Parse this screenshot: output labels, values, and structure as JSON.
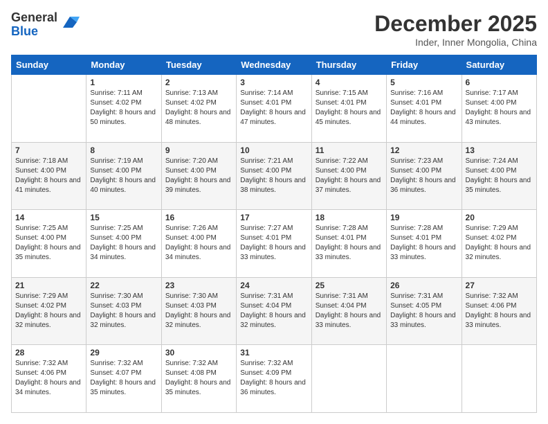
{
  "logo": {
    "general": "General",
    "blue": "Blue"
  },
  "header": {
    "month": "December 2025",
    "location": "Inder, Inner Mongolia, China"
  },
  "weekdays": [
    "Sunday",
    "Monday",
    "Tuesday",
    "Wednesday",
    "Thursday",
    "Friday",
    "Saturday"
  ],
  "weeks": [
    [
      {
        "day": "",
        "sunrise": "",
        "sunset": "",
        "daylight": ""
      },
      {
        "day": "1",
        "sunrise": "Sunrise: 7:11 AM",
        "sunset": "Sunset: 4:02 PM",
        "daylight": "Daylight: 8 hours and 50 minutes."
      },
      {
        "day": "2",
        "sunrise": "Sunrise: 7:13 AM",
        "sunset": "Sunset: 4:02 PM",
        "daylight": "Daylight: 8 hours and 48 minutes."
      },
      {
        "day": "3",
        "sunrise": "Sunrise: 7:14 AM",
        "sunset": "Sunset: 4:01 PM",
        "daylight": "Daylight: 8 hours and 47 minutes."
      },
      {
        "day": "4",
        "sunrise": "Sunrise: 7:15 AM",
        "sunset": "Sunset: 4:01 PM",
        "daylight": "Daylight: 8 hours and 45 minutes."
      },
      {
        "day": "5",
        "sunrise": "Sunrise: 7:16 AM",
        "sunset": "Sunset: 4:01 PM",
        "daylight": "Daylight: 8 hours and 44 minutes."
      },
      {
        "day": "6",
        "sunrise": "Sunrise: 7:17 AM",
        "sunset": "Sunset: 4:00 PM",
        "daylight": "Daylight: 8 hours and 43 minutes."
      }
    ],
    [
      {
        "day": "7",
        "sunrise": "Sunrise: 7:18 AM",
        "sunset": "Sunset: 4:00 PM",
        "daylight": "Daylight: 8 hours and 41 minutes."
      },
      {
        "day": "8",
        "sunrise": "Sunrise: 7:19 AM",
        "sunset": "Sunset: 4:00 PM",
        "daylight": "Daylight: 8 hours and 40 minutes."
      },
      {
        "day": "9",
        "sunrise": "Sunrise: 7:20 AM",
        "sunset": "Sunset: 4:00 PM",
        "daylight": "Daylight: 8 hours and 39 minutes."
      },
      {
        "day": "10",
        "sunrise": "Sunrise: 7:21 AM",
        "sunset": "Sunset: 4:00 PM",
        "daylight": "Daylight: 8 hours and 38 minutes."
      },
      {
        "day": "11",
        "sunrise": "Sunrise: 7:22 AM",
        "sunset": "Sunset: 4:00 PM",
        "daylight": "Daylight: 8 hours and 37 minutes."
      },
      {
        "day": "12",
        "sunrise": "Sunrise: 7:23 AM",
        "sunset": "Sunset: 4:00 PM",
        "daylight": "Daylight: 8 hours and 36 minutes."
      },
      {
        "day": "13",
        "sunrise": "Sunrise: 7:24 AM",
        "sunset": "Sunset: 4:00 PM",
        "daylight": "Daylight: 8 hours and 35 minutes."
      }
    ],
    [
      {
        "day": "14",
        "sunrise": "Sunrise: 7:25 AM",
        "sunset": "Sunset: 4:00 PM",
        "daylight": "Daylight: 8 hours and 35 minutes."
      },
      {
        "day": "15",
        "sunrise": "Sunrise: 7:25 AM",
        "sunset": "Sunset: 4:00 PM",
        "daylight": "Daylight: 8 hours and 34 minutes."
      },
      {
        "day": "16",
        "sunrise": "Sunrise: 7:26 AM",
        "sunset": "Sunset: 4:00 PM",
        "daylight": "Daylight: 8 hours and 34 minutes."
      },
      {
        "day": "17",
        "sunrise": "Sunrise: 7:27 AM",
        "sunset": "Sunset: 4:01 PM",
        "daylight": "Daylight: 8 hours and 33 minutes."
      },
      {
        "day": "18",
        "sunrise": "Sunrise: 7:28 AM",
        "sunset": "Sunset: 4:01 PM",
        "daylight": "Daylight: 8 hours and 33 minutes."
      },
      {
        "day": "19",
        "sunrise": "Sunrise: 7:28 AM",
        "sunset": "Sunset: 4:01 PM",
        "daylight": "Daylight: 8 hours and 33 minutes."
      },
      {
        "day": "20",
        "sunrise": "Sunrise: 7:29 AM",
        "sunset": "Sunset: 4:02 PM",
        "daylight": "Daylight: 8 hours and 32 minutes."
      }
    ],
    [
      {
        "day": "21",
        "sunrise": "Sunrise: 7:29 AM",
        "sunset": "Sunset: 4:02 PM",
        "daylight": "Daylight: 8 hours and 32 minutes."
      },
      {
        "day": "22",
        "sunrise": "Sunrise: 7:30 AM",
        "sunset": "Sunset: 4:03 PM",
        "daylight": "Daylight: 8 hours and 32 minutes."
      },
      {
        "day": "23",
        "sunrise": "Sunrise: 7:30 AM",
        "sunset": "Sunset: 4:03 PM",
        "daylight": "Daylight: 8 hours and 32 minutes."
      },
      {
        "day": "24",
        "sunrise": "Sunrise: 7:31 AM",
        "sunset": "Sunset: 4:04 PM",
        "daylight": "Daylight: 8 hours and 32 minutes."
      },
      {
        "day": "25",
        "sunrise": "Sunrise: 7:31 AM",
        "sunset": "Sunset: 4:04 PM",
        "daylight": "Daylight: 8 hours and 33 minutes."
      },
      {
        "day": "26",
        "sunrise": "Sunrise: 7:31 AM",
        "sunset": "Sunset: 4:05 PM",
        "daylight": "Daylight: 8 hours and 33 minutes."
      },
      {
        "day": "27",
        "sunrise": "Sunrise: 7:32 AM",
        "sunset": "Sunset: 4:06 PM",
        "daylight": "Daylight: 8 hours and 33 minutes."
      }
    ],
    [
      {
        "day": "28",
        "sunrise": "Sunrise: 7:32 AM",
        "sunset": "Sunset: 4:06 PM",
        "daylight": "Daylight: 8 hours and 34 minutes."
      },
      {
        "day": "29",
        "sunrise": "Sunrise: 7:32 AM",
        "sunset": "Sunset: 4:07 PM",
        "daylight": "Daylight: 8 hours and 35 minutes."
      },
      {
        "day": "30",
        "sunrise": "Sunrise: 7:32 AM",
        "sunset": "Sunset: 4:08 PM",
        "daylight": "Daylight: 8 hours and 35 minutes."
      },
      {
        "day": "31",
        "sunrise": "Sunrise: 7:32 AM",
        "sunset": "Sunset: 4:09 PM",
        "daylight": "Daylight: 8 hours and 36 minutes."
      },
      {
        "day": "",
        "sunrise": "",
        "sunset": "",
        "daylight": ""
      },
      {
        "day": "",
        "sunrise": "",
        "sunset": "",
        "daylight": ""
      },
      {
        "day": "",
        "sunrise": "",
        "sunset": "",
        "daylight": ""
      }
    ]
  ]
}
